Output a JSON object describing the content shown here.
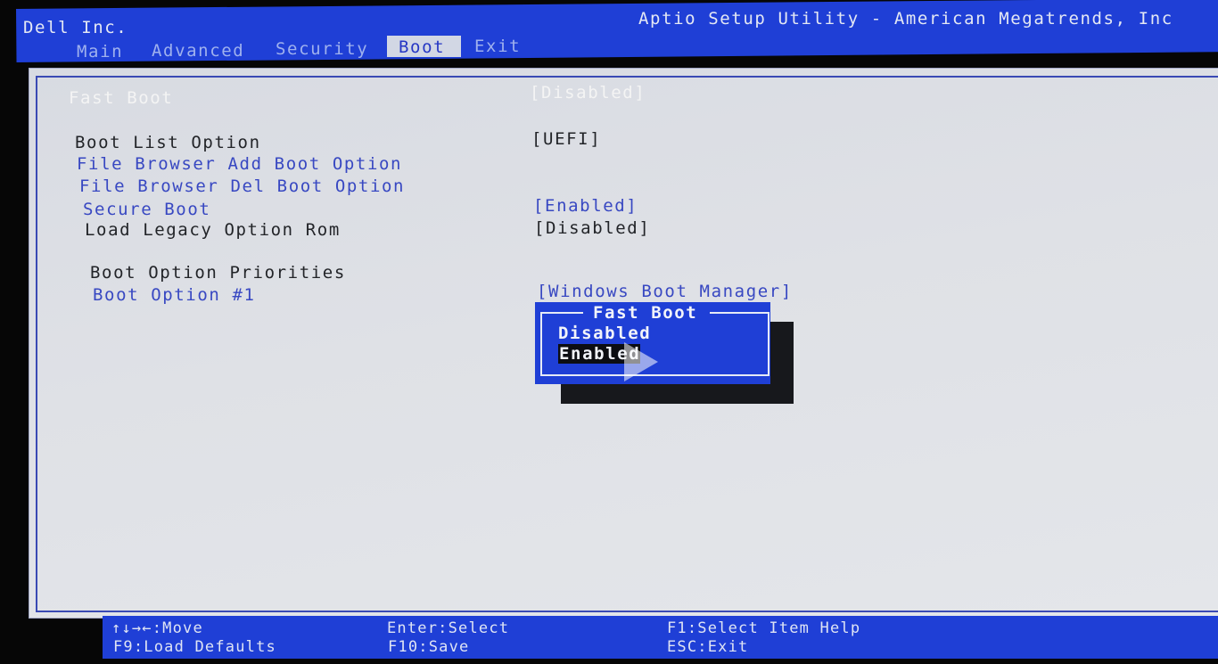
{
  "header": {
    "vendor": "Dell Inc.",
    "utility_title": "Aptio Setup Utility - American Megatrends, Inc",
    "tabs": [
      "Main",
      "Advanced",
      "Security",
      "Boot",
      "Exit"
    ],
    "active_tab": "Boot"
  },
  "settings": {
    "fast_boot": {
      "label": "Fast Boot",
      "value": "[Disabled]"
    },
    "boot_list_option": {
      "label": "Boot List Option",
      "value": "[UEFI]"
    },
    "file_browser_add": {
      "label": "File Browser Add Boot Option"
    },
    "file_browser_del": {
      "label": "File Browser Del Boot Option"
    },
    "secure_boot": {
      "label": "Secure Boot",
      "value": "[Enabled]"
    },
    "load_legacy_rom": {
      "label": "Load Legacy Option Rom",
      "value": "[Disabled]"
    },
    "boot_option_priorities": {
      "label": "Boot Option Priorities"
    },
    "boot_option_1": {
      "label": "Boot Option #1",
      "value": "[Windows Boot Manager]"
    }
  },
  "popup": {
    "title": "Fast Boot",
    "options": [
      "Disabled",
      "Enabled"
    ],
    "selected": "Enabled"
  },
  "footer": {
    "move": "↑↓→←:Move",
    "load_defaults": "F9:Load Defaults",
    "select": "Enter:Select",
    "save": "F10:Save",
    "item_help": "F1:Select Item Help",
    "exit": "ESC:Exit"
  },
  "colors": {
    "header_blue": "#1f3fd6",
    "panel_gray": "#dfe1e6",
    "link_blue": "#3848c2",
    "popup_blue": "#1f3fd6"
  },
  "icons": {
    "video_overlay": "play-icon"
  }
}
